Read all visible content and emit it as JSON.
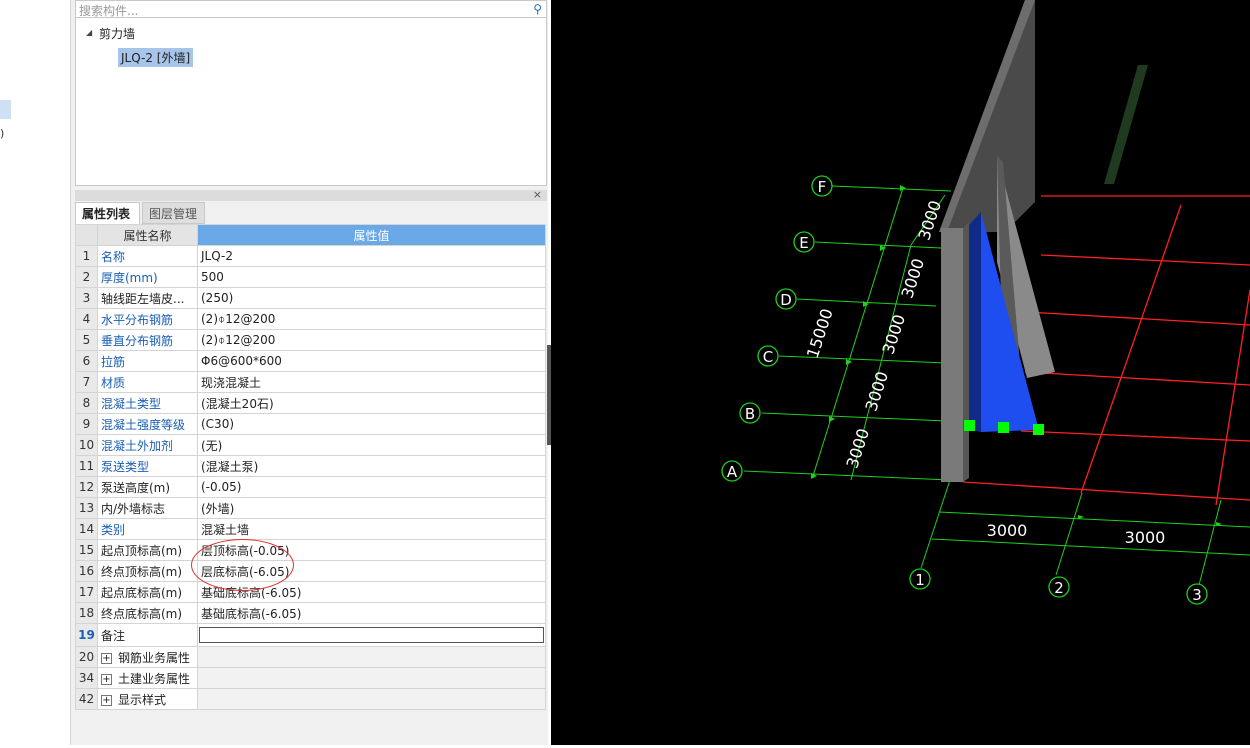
{
  "left_strip": {
    "fragment": ")"
  },
  "search": {
    "placeholder": "搜索构件..."
  },
  "tree": {
    "root": "剪力墙",
    "item": "JLQ-2 [外墙]"
  },
  "tabs": [
    "属性列表",
    "图层管理"
  ],
  "table": {
    "headers": [
      "属性名称",
      "属性值"
    ],
    "rows": [
      {
        "idx": "1",
        "name": "名称",
        "value": "JLQ-2",
        "blue": true
      },
      {
        "idx": "2",
        "name": "厚度(mm)",
        "value": "500",
        "blue": true
      },
      {
        "idx": "3",
        "name": "轴线距左墙皮...",
        "value": "(250)",
        "blue": false
      },
      {
        "idx": "4",
        "name": "水平分布钢筋",
        "value": "(2)⌽12@200",
        "blue": true
      },
      {
        "idx": "5",
        "name": "垂直分布钢筋",
        "value": "(2)⌽12@200",
        "blue": true
      },
      {
        "idx": "6",
        "name": "拉筋",
        "value": "Φ6@600*600",
        "blue": true
      },
      {
        "idx": "7",
        "name": "材质",
        "value": "现浇混凝土",
        "blue": true
      },
      {
        "idx": "8",
        "name": "混凝土类型",
        "value": "(混凝土20石)",
        "blue": true
      },
      {
        "idx": "9",
        "name": "混凝土强度等级",
        "value": "(C30)",
        "blue": true
      },
      {
        "idx": "10",
        "name": "混凝土外加剂",
        "value": "(无)",
        "blue": true
      },
      {
        "idx": "11",
        "name": "泵送类型",
        "value": "(混凝土泵)",
        "blue": true
      },
      {
        "idx": "12",
        "name": "泵送高度(m)",
        "value": "(-0.05)",
        "blue": false
      },
      {
        "idx": "13",
        "name": "内/外墙标志",
        "value": "(外墙)",
        "blue": false
      },
      {
        "idx": "14",
        "name": "类别",
        "value": "混凝土墙",
        "blue": true
      },
      {
        "idx": "15",
        "name": "起点顶标高(m)",
        "value": "层顶标高(-0.05)",
        "blue": false
      },
      {
        "idx": "16",
        "name": "终点顶标高(m)",
        "value": "层底标高(-6.05)",
        "blue": false
      },
      {
        "idx": "17",
        "name": "起点底标高(m)",
        "value": "基础底标高(-6.05)",
        "blue": false
      },
      {
        "idx": "18",
        "name": "终点底标高(m)",
        "value": "基础底标高(-6.05)",
        "blue": false
      }
    ],
    "note_row": {
      "idx": "19",
      "name": "备注"
    },
    "groups": [
      {
        "idx": "20",
        "name": "钢筋业务属性"
      },
      {
        "idx": "34",
        "name": "土建业务属性"
      },
      {
        "idx": "42",
        "name": "显示样式"
      }
    ]
  },
  "viewport": {
    "row_axes": [
      "A",
      "B",
      "C",
      "D",
      "E",
      "F"
    ],
    "col_axes": [
      "1",
      "2",
      "3"
    ],
    "row_spacings": [
      "3000",
      "3000",
      "3000",
      "3000",
      "3000"
    ],
    "col_spacings": [
      "3000",
      "3000"
    ],
    "total_dim": "15000",
    "colors": {
      "grid_green": "#1fd01f",
      "grid_red": "#ff2020",
      "wall_blue": "#1e4df0",
      "wall_gray": "#7a7a7a",
      "point_green": "#00ff00"
    }
  }
}
